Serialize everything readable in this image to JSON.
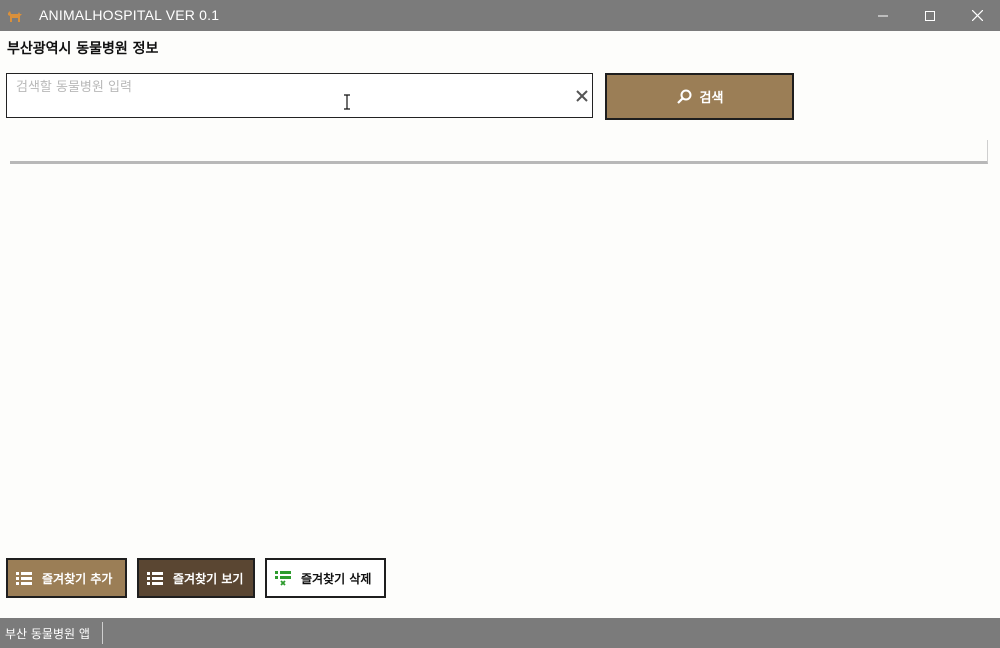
{
  "window": {
    "title": "ANIMALHOSPITAL VER 0.1",
    "app_icon": "dog-icon",
    "controls": [
      "minimize-icon",
      "maximize-icon",
      "close-icon"
    ]
  },
  "header": {
    "title": "부산광역시 동물병원 정보"
  },
  "search": {
    "placeholder": "검색할 동물병원 입력",
    "value": "",
    "button_label": "검색",
    "button_icon": "search-icon"
  },
  "results": [],
  "favorites": {
    "add_label": "즐겨찾기 추가",
    "view_label": "즐겨찾기 보기",
    "delete_label": "즐겨찾기 삭제"
  },
  "status": {
    "text": "부산 동물병원 앱"
  },
  "colors": {
    "titlebar": "#7b7b7b",
    "accent_brown": "#9b7e56",
    "dark_brown": "#5a4632",
    "green_icon": "#2e9b2e"
  }
}
